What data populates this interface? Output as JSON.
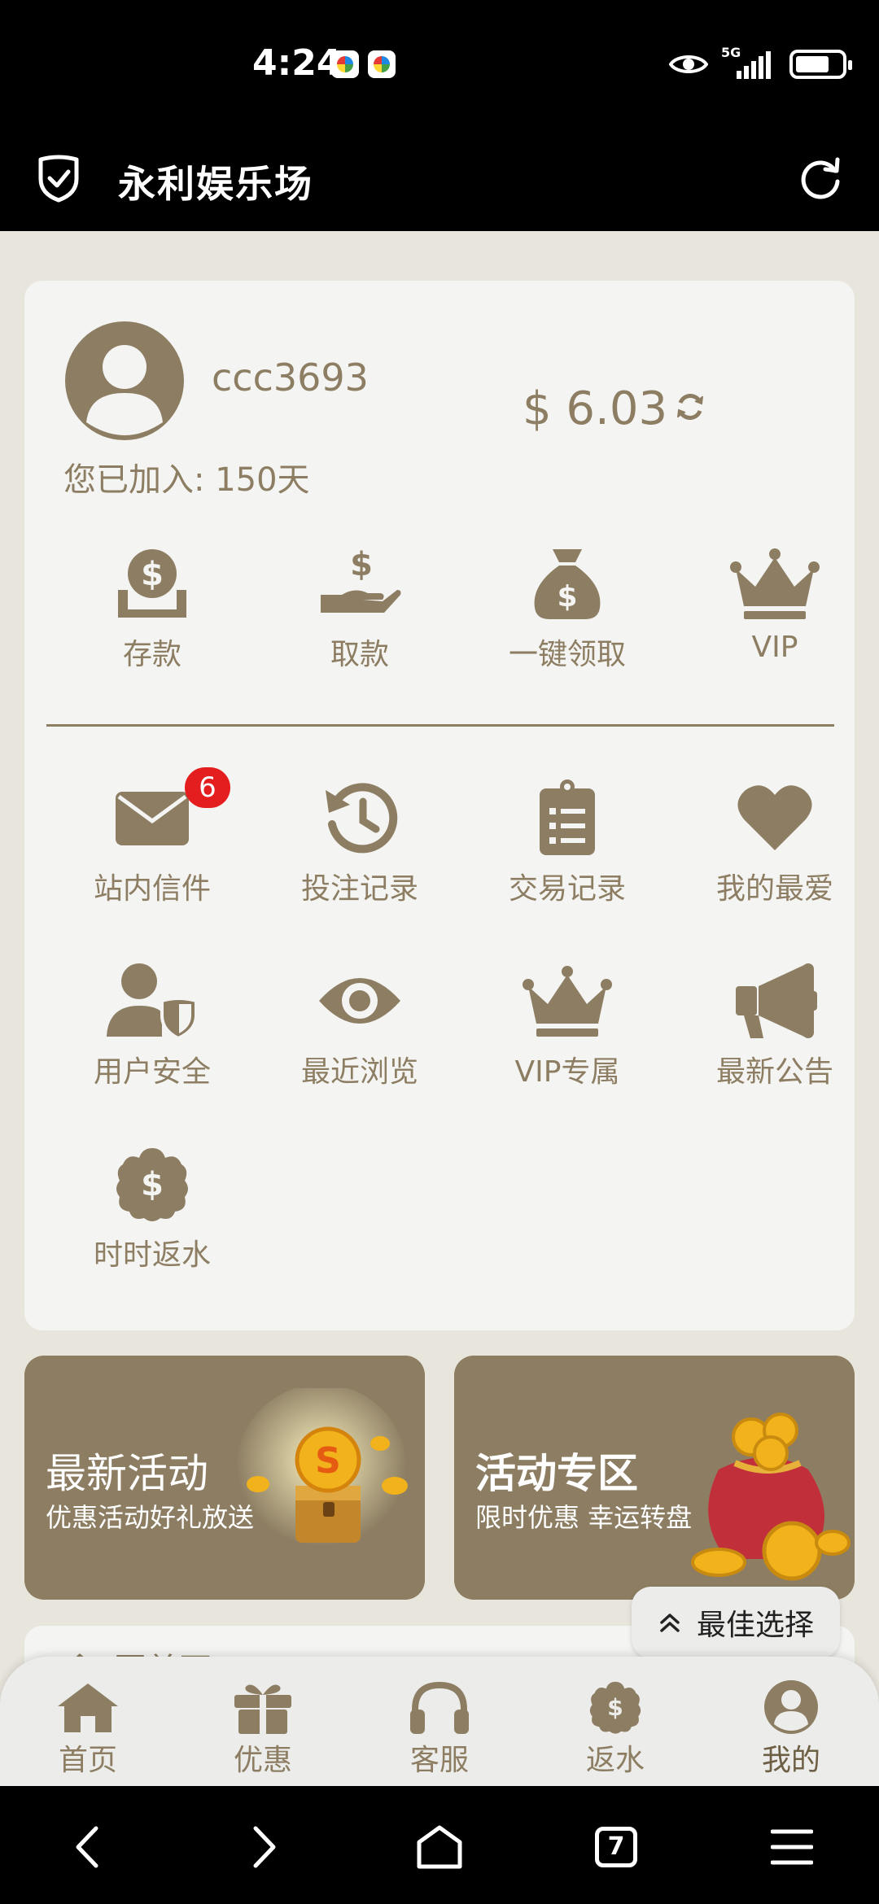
{
  "status_bar": {
    "time": "4:24",
    "network": "5G",
    "icons": [
      "eye-icon",
      "signal-icon",
      "battery-icon"
    ]
  },
  "header": {
    "title": "永利娱乐场",
    "left_icon": "shield-check-icon",
    "right_icon": "refresh-icon"
  },
  "profile": {
    "username": "ccc3693",
    "balance": "$ 6.03",
    "joined": "您已加入: 150天"
  },
  "quick_actions": [
    {
      "label": "存款",
      "icon": "deposit-icon"
    },
    {
      "label": "取款",
      "icon": "withdraw-icon"
    },
    {
      "label": "一键领取",
      "icon": "money-bag-icon"
    },
    {
      "label": "VIP",
      "icon": "crown-icon"
    }
  ],
  "menu": [
    {
      "label": "站内信件",
      "icon": "mail-icon",
      "badge": "6"
    },
    {
      "label": "投注记录",
      "icon": "history-icon"
    },
    {
      "label": "交易记录",
      "icon": "clipboard-icon"
    },
    {
      "label": "我的最爱",
      "icon": "heart-icon"
    },
    {
      "label": "用户安全",
      "icon": "user-shield-icon"
    },
    {
      "label": "最近浏览",
      "icon": "eye-icon"
    },
    {
      "label": "VIP专属",
      "icon": "crown-icon"
    },
    {
      "label": "最新公告",
      "icon": "megaphone-icon"
    },
    {
      "label": "时时返水",
      "icon": "rebate-icon"
    }
  ],
  "banners": [
    {
      "title": "最新活动",
      "subtitle": "优惠活动好礼放送",
      "image": "treasure-chest-icon"
    },
    {
      "title": "活动专区",
      "subtitle": "限时优惠 幸运转盘",
      "image": "lucky-bag-icon"
    }
  ],
  "peek_card": {
    "label": "回首页"
  },
  "best_choice": {
    "label": "最佳选择"
  },
  "bottom_nav": [
    {
      "label": "首页",
      "icon": "home-icon"
    },
    {
      "label": "优惠",
      "icon": "gift-icon"
    },
    {
      "label": "客服",
      "icon": "headset-icon"
    },
    {
      "label": "返水",
      "icon": "rebate-icon"
    },
    {
      "label": "我的",
      "icon": "user-icon"
    }
  ],
  "system_nav": {
    "tab_count": "7"
  },
  "colors": {
    "accent": "#8d7e63",
    "background": "#e8e5dc",
    "card": "#f4f4f2",
    "badge": "#e41e1e"
  }
}
